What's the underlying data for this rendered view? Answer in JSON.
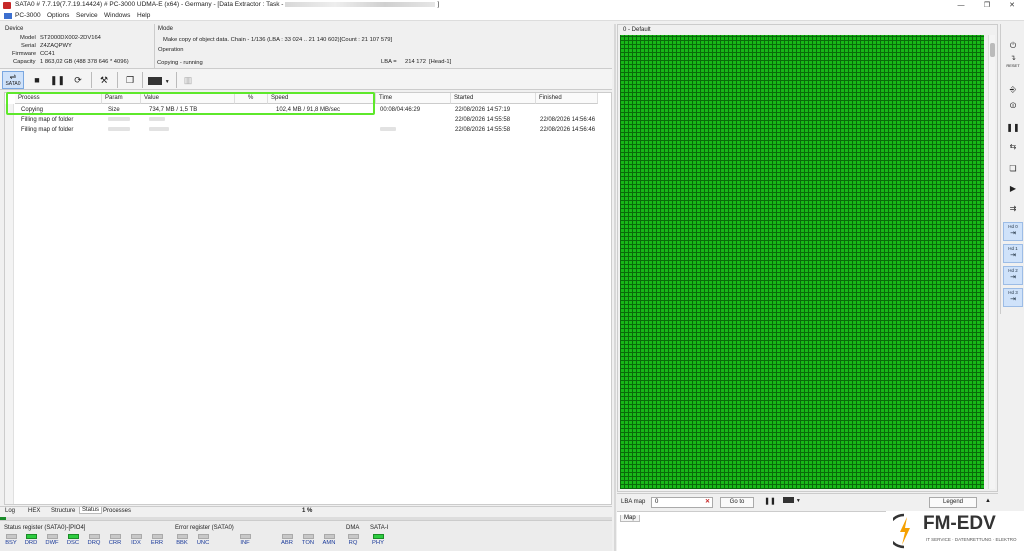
{
  "window": {
    "title_left": "SATA0 # 7.7.19(7.7.19.14424) # PC-3000 UDMA-E (x64) - Germany - [Data Extractor : Task -",
    "title_right": "]"
  },
  "menu": [
    "PC-3000",
    "Options",
    "Service",
    "Windows",
    "Help"
  ],
  "device": {
    "header": "Device",
    "model_label": "Model",
    "model": "ST2000DX002-2DV164",
    "serial_label": "Serial",
    "serial": "Z4ZAQPWY",
    "firmware_label": "Firmware",
    "firmware": "CC41",
    "capacity_label": "Capacity",
    "capacity": "1 863,02 GB (488 378 646 * 4096)"
  },
  "mode": {
    "header": "Mode",
    "text": "Make copy of object data. Chain - 1/136 (LBA : 33 024 .. 21 140 602)[Count : 21 107 579]",
    "operation_label": "Operation",
    "operation": "Copying - running",
    "lba_label": "LBA =",
    "lba_value": "214 172",
    "head": "[Head-1]"
  },
  "toolbar": {
    "sata_label": "SATA0"
  },
  "table": {
    "headers": [
      "Process",
      "Param",
      "Value",
      "%",
      "Speed",
      "Time",
      "Started",
      "Finished"
    ],
    "rows": [
      {
        "process": "Copying",
        "param": "Size",
        "value": "734,7 MB / 1,5 TB",
        "pct": "",
        "speed": "102,4 MB / 91,8 MB/sec",
        "time": "00:08/04:46:29",
        "started": "22/08/2026 14:57:19",
        "finished": ""
      },
      {
        "process": "Filling map of folder",
        "param": "",
        "value": "",
        "pct": "",
        "speed": "",
        "time": "",
        "started": "22/08/2026 14:55:58",
        "finished": "22/08/2026 14:56:46"
      },
      {
        "process": "Filling map of folder",
        "param": "",
        "value": "",
        "pct": "",
        "speed": "",
        "time": "",
        "started": "22/08/2026 14:55:58",
        "finished": "22/08/2026 14:56:46"
      }
    ]
  },
  "bottom_tabs": [
    "Log",
    "HEX",
    "Structure",
    "Status",
    "Processes"
  ],
  "bottom_percent": "1 %",
  "status_register": {
    "label": "Status register (SATA0)-[PIO4]",
    "bits": [
      {
        "name": "BSY",
        "on": false
      },
      {
        "name": "DRD",
        "on": true
      },
      {
        "name": "DWF",
        "on": false
      },
      {
        "name": "DSC",
        "on": true
      },
      {
        "name": "DRQ",
        "on": false
      },
      {
        "name": "CRR",
        "on": false
      },
      {
        "name": "IDX",
        "on": false
      },
      {
        "name": "ERR",
        "on": false
      }
    ]
  },
  "error_register": {
    "label": "Error register (SATA0)",
    "bits": [
      {
        "name": "BBK",
        "on": false
      },
      {
        "name": "UNC",
        "on": false
      },
      {
        "name": "INF",
        "on": false
      },
      {
        "name": "ABR",
        "on": false
      },
      {
        "name": "TON",
        "on": false
      },
      {
        "name": "AMN",
        "on": false
      }
    ]
  },
  "dma": {
    "label": "DMA",
    "bit": {
      "name": "RQ",
      "on": false
    }
  },
  "sata": {
    "label": "SATA-I",
    "bit": {
      "name": "PHY",
      "on": true
    }
  },
  "map": {
    "title": "0 - Default",
    "lba_map_label": "LBA map",
    "lba_map_value": "0",
    "goto_label": "Go to",
    "legend_label": "Legend",
    "tab_label": "Map",
    "color": "#18b818"
  },
  "right_tools": {
    "reset_label": "RESET",
    "heads": [
      "Hd 0",
      "Hd 1",
      "Hd 2",
      "Hd 3"
    ]
  },
  "logo": {
    "name": "FM-EDV",
    "tagline": "IT SERVICE · DATENRETTUNG · ELEKTRO"
  }
}
